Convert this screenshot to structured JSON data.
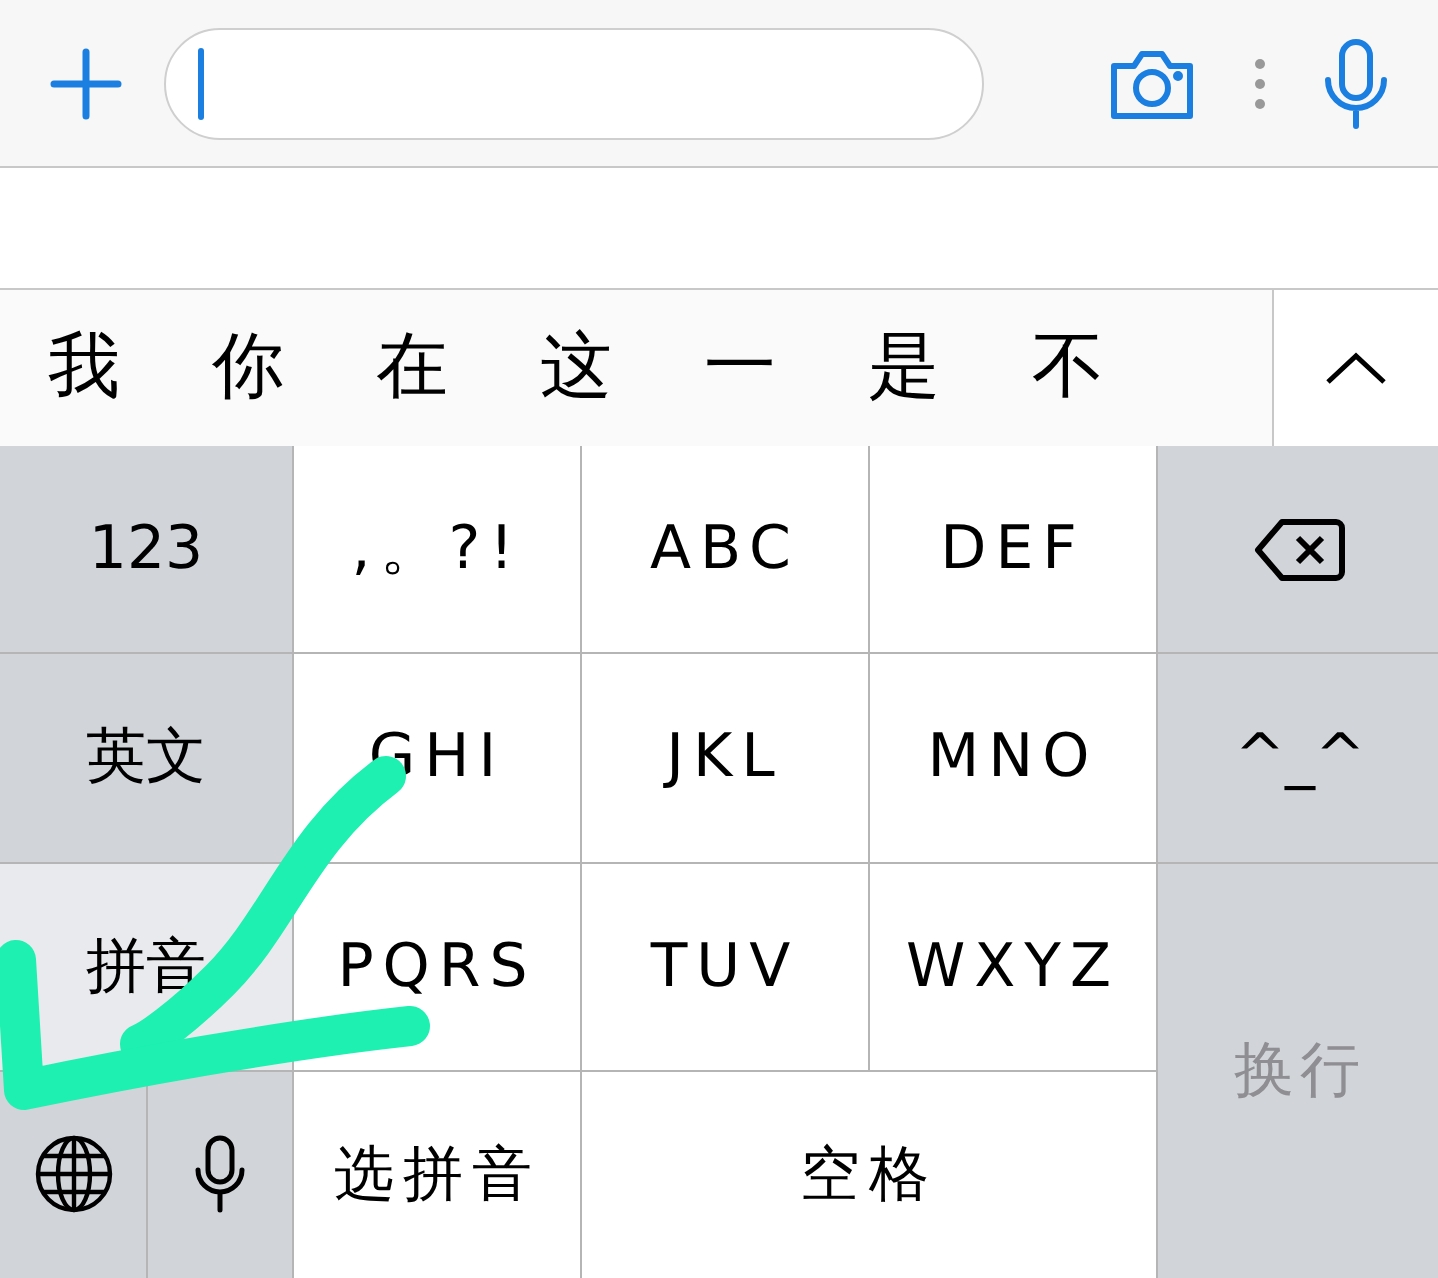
{
  "input_bar": {
    "field": {
      "focused": true
    }
  },
  "candidates": {
    "items": [
      "我",
      "你",
      "在",
      "这",
      "一",
      "是",
      "不"
    ]
  },
  "keyboard": {
    "keys": [
      {
        "kind": "function",
        "label": "123"
      },
      {
        "kind": "letter",
        "label": ",。?!"
      },
      {
        "kind": "letter",
        "label": "ABC"
      },
      {
        "kind": "letter",
        "label": "DEF"
      },
      {
        "kind": "backspace"
      },
      {
        "kind": "function",
        "label": "英文",
        "selected": false
      },
      {
        "kind": "letter",
        "label": "GHI"
      },
      {
        "kind": "letter",
        "label": "JKL"
      },
      {
        "kind": "letter",
        "label": "MNO"
      },
      {
        "kind": "function",
        "label": "^_^"
      },
      {
        "kind": "function",
        "label": "拼音",
        "selected": true
      },
      {
        "kind": "letter",
        "label": "PQRS"
      },
      {
        "kind": "letter",
        "label": "TUV"
      },
      {
        "kind": "letter",
        "label": "WXYZ"
      },
      {
        "kind": "return",
        "label": "换行",
        "disabled": true
      },
      {
        "kind": "globe"
      },
      {
        "kind": "mic"
      },
      {
        "kind": "letter",
        "label": "选拼音"
      },
      {
        "kind": "letter",
        "label": "空格"
      }
    ]
  },
  "annotation": {
    "kind": "arrow"
  }
}
